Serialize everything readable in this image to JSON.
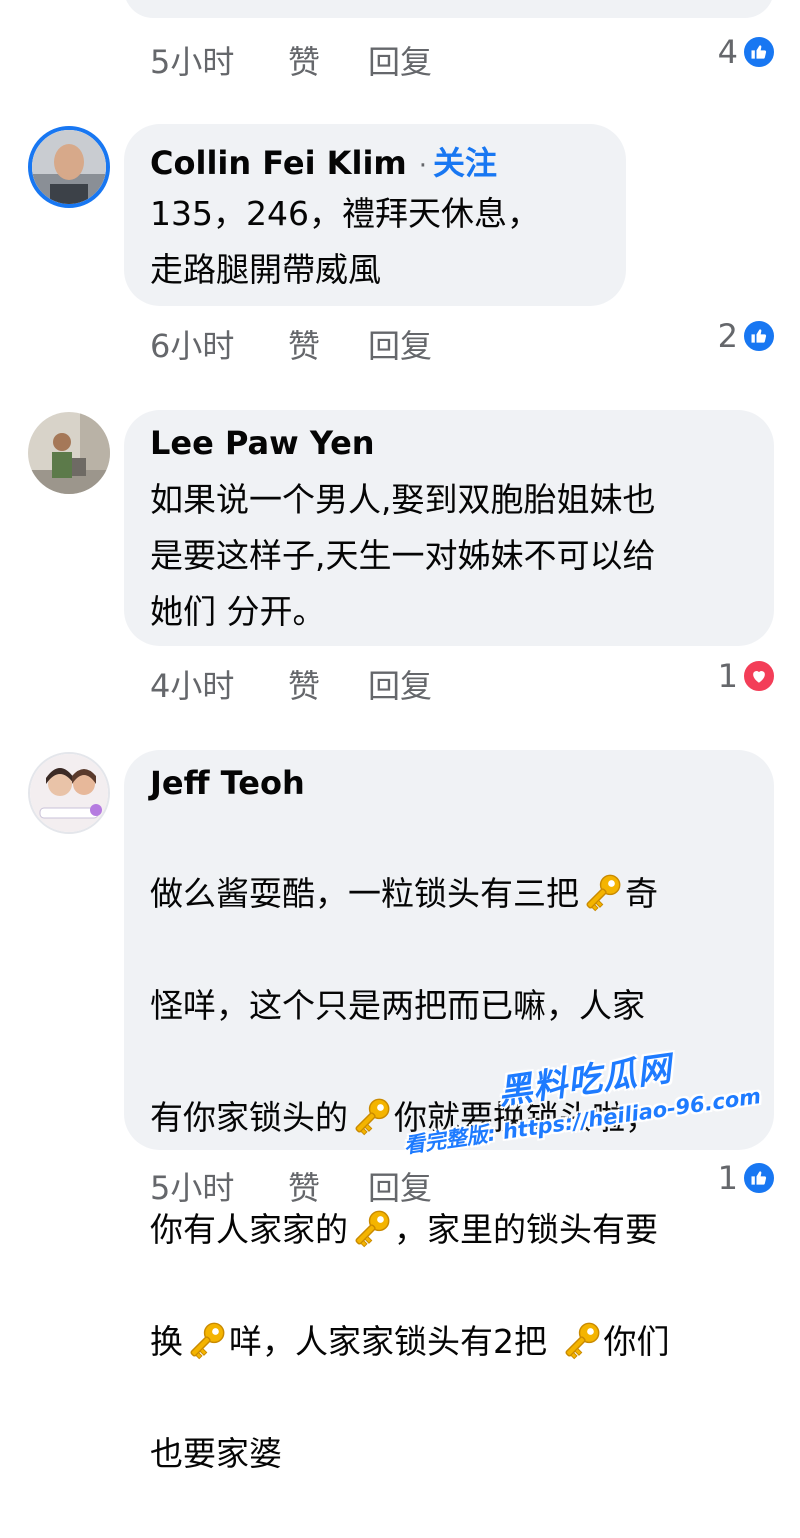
{
  "colors": {
    "bubble": "#f0f2f5",
    "accent": "#1877f2",
    "meta": "#65676b",
    "love": "#f33e58"
  },
  "top_comment": {
    "time": "5小时",
    "like_label": "赞",
    "reply_label": "回复",
    "reaction_count": "4",
    "reaction_icon": "like-icon"
  },
  "comments": [
    {
      "author": "Collin Fei Klim",
      "follow_label": "关注",
      "lines": [
        "135，246，禮拜天休息，",
        "走路腿開帶威風"
      ],
      "time": "6小时",
      "like_label": "赞",
      "reply_label": "回复",
      "reaction_count": "2",
      "reaction_icon": "like-icon"
    },
    {
      "author": "Lee Paw Yen",
      "lines": [
        "如果说一个男人,娶到双胞胎姐妹也",
        "是要这样子,天生一对姊妹不可以给",
        "她们 分开。"
      ],
      "time": "4小时",
      "like_label": "赞",
      "reply_label": "回复",
      "reaction_count": "1",
      "reaction_icon": "love-icon"
    },
    {
      "author": "Jeff Teoh",
      "lines": [
        [
          "做么酱耍酷，一粒锁头有三把",
          "奇"
        ],
        [
          "怪咩，这个只是两把而已嘛，人家"
        ],
        [
          "有你家锁头的",
          "你就要换锁头啦，"
        ],
        [
          "你有人家家的",
          "，家里的锁头有要"
        ],
        [
          "换",
          "咩，人家家锁头有2把 ",
          "你们"
        ],
        [
          "也要家婆"
        ]
      ],
      "key_emoji": "key-icon",
      "time": "5小时",
      "like_label": "赞",
      "reply_label": "回复",
      "reaction_count": "1",
      "reaction_icon": "like-icon"
    }
  ],
  "watermark": {
    "logo_text": "黑料吃瓜网",
    "url_text": "看完整版: https://heiliao-96.com"
  }
}
